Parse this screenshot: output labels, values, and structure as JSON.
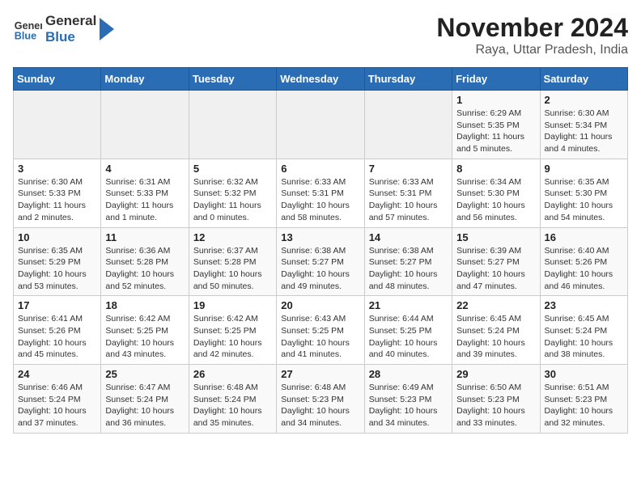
{
  "logo": {
    "line1": "General",
    "line2": "Blue"
  },
  "title": "November 2024",
  "subtitle": "Raya, Uttar Pradesh, India",
  "weekdays": [
    "Sunday",
    "Monday",
    "Tuesday",
    "Wednesday",
    "Thursday",
    "Friday",
    "Saturday"
  ],
  "weeks": [
    [
      {
        "day": "",
        "info": ""
      },
      {
        "day": "",
        "info": ""
      },
      {
        "day": "",
        "info": ""
      },
      {
        "day": "",
        "info": ""
      },
      {
        "day": "",
        "info": ""
      },
      {
        "day": "1",
        "info": "Sunrise: 6:29 AM\nSunset: 5:35 PM\nDaylight: 11 hours and 5 minutes."
      },
      {
        "day": "2",
        "info": "Sunrise: 6:30 AM\nSunset: 5:34 PM\nDaylight: 11 hours and 4 minutes."
      }
    ],
    [
      {
        "day": "3",
        "info": "Sunrise: 6:30 AM\nSunset: 5:33 PM\nDaylight: 11 hours and 2 minutes."
      },
      {
        "day": "4",
        "info": "Sunrise: 6:31 AM\nSunset: 5:33 PM\nDaylight: 11 hours and 1 minute."
      },
      {
        "day": "5",
        "info": "Sunrise: 6:32 AM\nSunset: 5:32 PM\nDaylight: 11 hours and 0 minutes."
      },
      {
        "day": "6",
        "info": "Sunrise: 6:33 AM\nSunset: 5:31 PM\nDaylight: 10 hours and 58 minutes."
      },
      {
        "day": "7",
        "info": "Sunrise: 6:33 AM\nSunset: 5:31 PM\nDaylight: 10 hours and 57 minutes."
      },
      {
        "day": "8",
        "info": "Sunrise: 6:34 AM\nSunset: 5:30 PM\nDaylight: 10 hours and 56 minutes."
      },
      {
        "day": "9",
        "info": "Sunrise: 6:35 AM\nSunset: 5:30 PM\nDaylight: 10 hours and 54 minutes."
      }
    ],
    [
      {
        "day": "10",
        "info": "Sunrise: 6:35 AM\nSunset: 5:29 PM\nDaylight: 10 hours and 53 minutes."
      },
      {
        "day": "11",
        "info": "Sunrise: 6:36 AM\nSunset: 5:28 PM\nDaylight: 10 hours and 52 minutes."
      },
      {
        "day": "12",
        "info": "Sunrise: 6:37 AM\nSunset: 5:28 PM\nDaylight: 10 hours and 50 minutes."
      },
      {
        "day": "13",
        "info": "Sunrise: 6:38 AM\nSunset: 5:27 PM\nDaylight: 10 hours and 49 minutes."
      },
      {
        "day": "14",
        "info": "Sunrise: 6:38 AM\nSunset: 5:27 PM\nDaylight: 10 hours and 48 minutes."
      },
      {
        "day": "15",
        "info": "Sunrise: 6:39 AM\nSunset: 5:27 PM\nDaylight: 10 hours and 47 minutes."
      },
      {
        "day": "16",
        "info": "Sunrise: 6:40 AM\nSunset: 5:26 PM\nDaylight: 10 hours and 46 minutes."
      }
    ],
    [
      {
        "day": "17",
        "info": "Sunrise: 6:41 AM\nSunset: 5:26 PM\nDaylight: 10 hours and 45 minutes."
      },
      {
        "day": "18",
        "info": "Sunrise: 6:42 AM\nSunset: 5:25 PM\nDaylight: 10 hours and 43 minutes."
      },
      {
        "day": "19",
        "info": "Sunrise: 6:42 AM\nSunset: 5:25 PM\nDaylight: 10 hours and 42 minutes."
      },
      {
        "day": "20",
        "info": "Sunrise: 6:43 AM\nSunset: 5:25 PM\nDaylight: 10 hours and 41 minutes."
      },
      {
        "day": "21",
        "info": "Sunrise: 6:44 AM\nSunset: 5:25 PM\nDaylight: 10 hours and 40 minutes."
      },
      {
        "day": "22",
        "info": "Sunrise: 6:45 AM\nSunset: 5:24 PM\nDaylight: 10 hours and 39 minutes."
      },
      {
        "day": "23",
        "info": "Sunrise: 6:45 AM\nSunset: 5:24 PM\nDaylight: 10 hours and 38 minutes."
      }
    ],
    [
      {
        "day": "24",
        "info": "Sunrise: 6:46 AM\nSunset: 5:24 PM\nDaylight: 10 hours and 37 minutes."
      },
      {
        "day": "25",
        "info": "Sunrise: 6:47 AM\nSunset: 5:24 PM\nDaylight: 10 hours and 36 minutes."
      },
      {
        "day": "26",
        "info": "Sunrise: 6:48 AM\nSunset: 5:24 PM\nDaylight: 10 hours and 35 minutes."
      },
      {
        "day": "27",
        "info": "Sunrise: 6:48 AM\nSunset: 5:23 PM\nDaylight: 10 hours and 34 minutes."
      },
      {
        "day": "28",
        "info": "Sunrise: 6:49 AM\nSunset: 5:23 PM\nDaylight: 10 hours and 34 minutes."
      },
      {
        "day": "29",
        "info": "Sunrise: 6:50 AM\nSunset: 5:23 PM\nDaylight: 10 hours and 33 minutes."
      },
      {
        "day": "30",
        "info": "Sunrise: 6:51 AM\nSunset: 5:23 PM\nDaylight: 10 hours and 32 minutes."
      }
    ]
  ]
}
